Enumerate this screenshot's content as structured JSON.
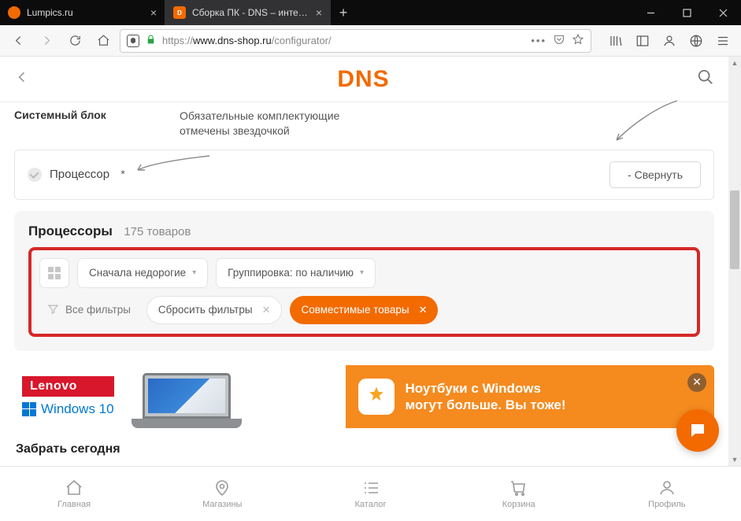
{
  "tabs": [
    {
      "label": "Lumpics.ru"
    },
    {
      "label": "Сборка ПК - DNS – интернет м"
    }
  ],
  "url": {
    "prefix": "https://",
    "host": "www.dns-shop.ru",
    "path": "/configurator/"
  },
  "site": {
    "logo": "DNS"
  },
  "top": {
    "left": "Системный блок",
    "note1": "Обязательные комплектующие",
    "note2": "отмечены звездочкой"
  },
  "proc": {
    "label": "Процессор",
    "star": "*",
    "collapse": "- Свернуть"
  },
  "panel": {
    "title": "Процессоры",
    "count": "175 товаров"
  },
  "controls": {
    "sort": "Сначала недорогие",
    "group": "Группировка: по наличию",
    "allfilters": "Все фильтры",
    "reset": "Сбросить фильтры",
    "compat": "Совместимые товары"
  },
  "banner": {
    "lenovo": "Lenovo",
    "win": "Windows 10",
    "line1": "Ноутбуки с Windows",
    "line2": "могут больше. Вы тоже!"
  },
  "pickup": "Забрать сегодня",
  "nav": {
    "home": "Главная",
    "stores": "Магазины",
    "catalog": "Каталог",
    "cart": "Корзина",
    "profile": "Профиль"
  }
}
